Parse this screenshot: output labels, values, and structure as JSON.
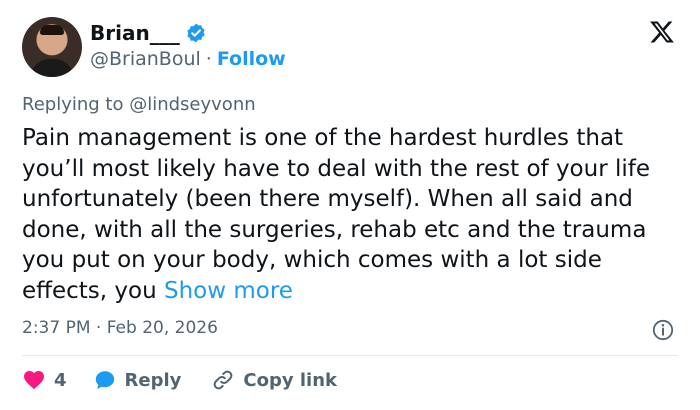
{
  "author": {
    "name": "Brian___",
    "handle": "@BrianBoul",
    "separator": "·",
    "follow_label": "Follow",
    "verified_icon": "verified-badge-icon",
    "verified_color": "#1d9bf0"
  },
  "brand_icon": "x-logo-icon",
  "reply_context": {
    "prefix": "Replying to",
    "mention": "@lindseyvonn"
  },
  "post": {
    "text": "Pain management is one of the hardest hurdles that you’ll most likely have to deal with the rest of your life unfortunately (been there myself). When all said and done, with all the surgeries, rehab etc and the trauma you put on your body, which comes with a lot side effects, you",
    "show_more_label": "Show more",
    "timestamp": "2:37 PM · Feb 20, 2026"
  },
  "actions": {
    "likes": "4",
    "reply_label": "Reply",
    "copy_link_label": "Copy link"
  },
  "colors": {
    "accent": "#1d9bf0",
    "like": "#f91880",
    "text": "#0f1419",
    "muted": "#536471"
  }
}
